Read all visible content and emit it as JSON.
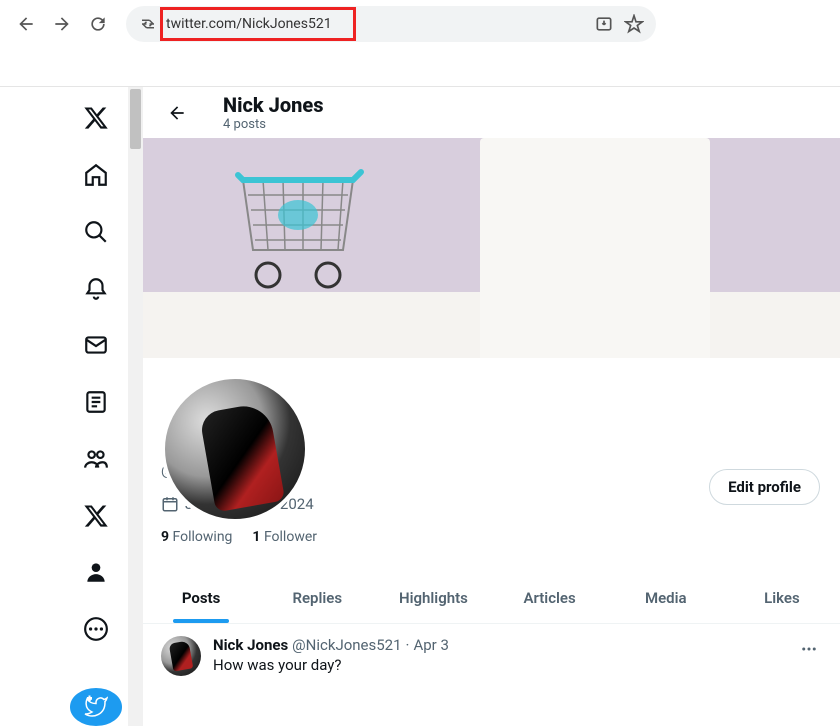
{
  "browser": {
    "url": "twitter.com/NickJones521"
  },
  "header": {
    "name": "Nick Jones",
    "post_count": "4 posts"
  },
  "profile": {
    "name": "Nick Jones",
    "handle": "@NickJones521",
    "joined": "Joined March 2024",
    "following_count": "9",
    "following_label": "Following",
    "followers_count": "1",
    "followers_label": "Follower",
    "edit_label": "Edit profile"
  },
  "tabs": [
    {
      "label": "Posts",
      "active": true
    },
    {
      "label": "Replies"
    },
    {
      "label": "Highlights"
    },
    {
      "label": "Articles"
    },
    {
      "label": "Media"
    },
    {
      "label": "Likes"
    }
  ],
  "post": {
    "name": "Nick Jones",
    "handle": "@NickJones521",
    "separator": "·",
    "date": "Apr 3",
    "text": "How was your day?"
  }
}
